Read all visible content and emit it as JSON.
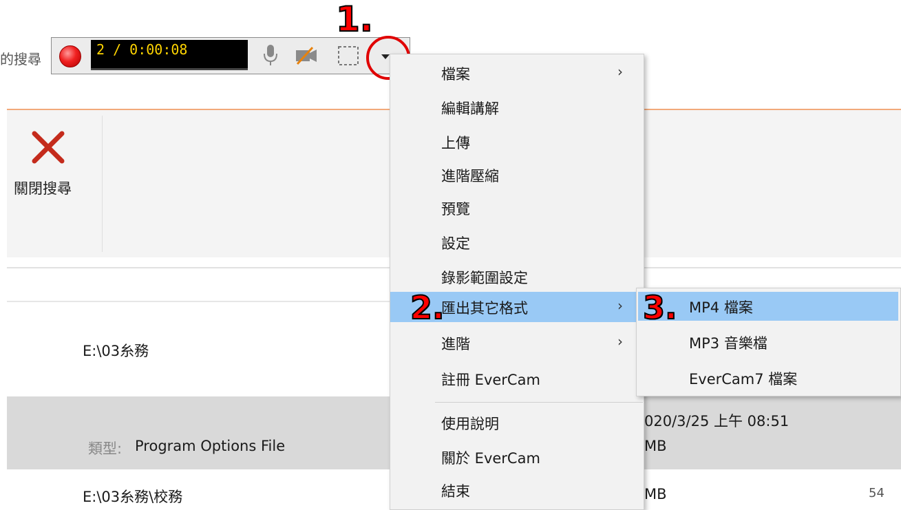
{
  "background": {
    "search_fragment": "的搜尋",
    "close_search_label": "關閉搜尋",
    "path_row_1": "E:\\03糸務",
    "type_label": "類型:",
    "type_value": "Program Options File",
    "date_text": "020/3/25 上午 08:51",
    "size_text_1": "MB",
    "path_row_2": "E:\\03糸務\\校務",
    "size_text_2": "MB",
    "page_number": "54"
  },
  "recorder": {
    "timer": "2 / 0:00:08",
    "icons": [
      "record-icon",
      "mic-icon",
      "camera-off-icon",
      "region-select-icon",
      "dropdown-arrow-icon"
    ]
  },
  "annotations": {
    "step1": "1.",
    "step2": "2.",
    "step3": "3."
  },
  "menu": {
    "items": [
      {
        "label": "檔案",
        "has_submenu": true
      },
      {
        "label": "編輯講解",
        "has_submenu": false
      },
      {
        "label": "上傳",
        "has_submenu": false
      },
      {
        "label": "進階壓縮",
        "has_submenu": false
      },
      {
        "label": "預覽",
        "has_submenu": false
      },
      {
        "label": "設定",
        "has_submenu": false
      },
      {
        "label": "錄影範圍設定",
        "has_submenu": false
      },
      {
        "label": "匯出其它格式",
        "has_submenu": true,
        "highlighted": true
      },
      {
        "label": "進階",
        "has_submenu": true
      },
      {
        "label": "註冊 EverCam",
        "has_submenu": false
      },
      {
        "label": "使用說明",
        "has_submenu": false
      },
      {
        "label": "關於 EverCam",
        "has_submenu": false
      },
      {
        "label": "結束",
        "has_submenu": false
      }
    ],
    "arrow": "›"
  },
  "submenu": {
    "items": [
      {
        "label": "MP4 檔案",
        "highlighted": true
      },
      {
        "label": "MP3 音樂檔",
        "highlighted": false
      },
      {
        "label": "EverCam7 檔案",
        "highlighted": false
      }
    ]
  },
  "colors": {
    "highlight": "#99c9f5",
    "accent_line": "#f2a97a",
    "annotation": "#ff0000",
    "timer_text": "#ffd400"
  }
}
